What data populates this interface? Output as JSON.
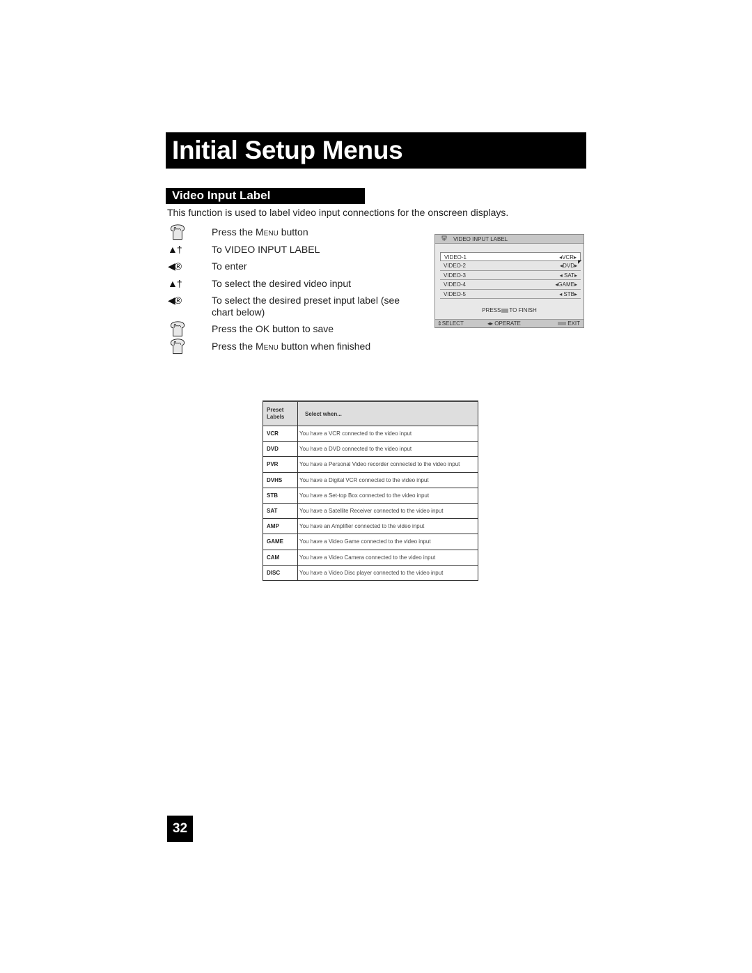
{
  "header": {
    "title": "Initial Setup Menus"
  },
  "section": {
    "title": "Video Input Label",
    "intro": "This function is used to label video input connections for the onscreen displays."
  },
  "steps": [
    {
      "icon": "remote-button-hand-icon",
      "text_pre": "Press the ",
      "text_sc": "Menu",
      "text_post": " button"
    },
    {
      "icon": "up-down-arrows-icon",
      "glyph": "▲†",
      "text": "To VIDEO INPUT LABEL"
    },
    {
      "icon": "left-right-arrows-icon",
      "glyph": "◀®",
      "text": "To enter"
    },
    {
      "icon": "up-down-arrows-icon",
      "glyph": "▲†",
      "text": "To select the desired video input"
    },
    {
      "icon": "left-right-arrows-icon",
      "glyph": "◀®",
      "text": "To select the desired preset input label (see chart below)"
    },
    {
      "icon": "remote-button-hand-icon",
      "text": "Press the OK button to save"
    },
    {
      "icon": "remote-button-hand-icon",
      "text_pre": "Press the ",
      "text_sc": "Menu",
      "text_post": " button when finished"
    }
  ],
  "osd": {
    "title": "VIDEO INPUT LABEL",
    "rows": [
      {
        "name": "VIDEO-1",
        "value": "◂VCR▸",
        "selected": true
      },
      {
        "name": "VIDEO-2",
        "value": "◂DVD▸"
      },
      {
        "name": "VIDEO-3",
        "value": "◂ SAT▸"
      },
      {
        "name": "VIDEO-4",
        "value": "◂GAME▸"
      },
      {
        "name": "VIDEO-5",
        "value": "◂ STB▸"
      }
    ],
    "finish_pre": "PRESS",
    "finish_post": "TO FINISH",
    "footer": {
      "select": "⇕SELECT",
      "operate": "◂▸ OPERATE",
      "exit": "EXIT"
    }
  },
  "preset_table": {
    "headers": [
      "Preset Labels",
      "Select when..."
    ],
    "rows": [
      {
        "label": "VCR",
        "desc": "You have a VCR connected to the video input"
      },
      {
        "label": "DVD",
        "desc": "You have a DVD connected to the video input"
      },
      {
        "label": "PVR",
        "desc": "You have a Personal Video recorder connected to the video input"
      },
      {
        "label": "DVHS",
        "desc": "You have a Digital VCR connected to the video input"
      },
      {
        "label": "STB",
        "desc": "You have a Set-top Box connected to the video input"
      },
      {
        "label": "SAT",
        "desc": "You have a Satellite Receiver connected to the video input"
      },
      {
        "label": "AMP",
        "desc": "You have an Amplifier connected to the video input"
      },
      {
        "label": "GAME",
        "desc": "You have a Video Game connected to the video input"
      },
      {
        "label": "CAM",
        "desc": "You have a Video Camera connected to the video input"
      },
      {
        "label": "DISC",
        "desc": "You have a Video Disc player connected to the video input"
      }
    ]
  },
  "page_number": "32"
}
